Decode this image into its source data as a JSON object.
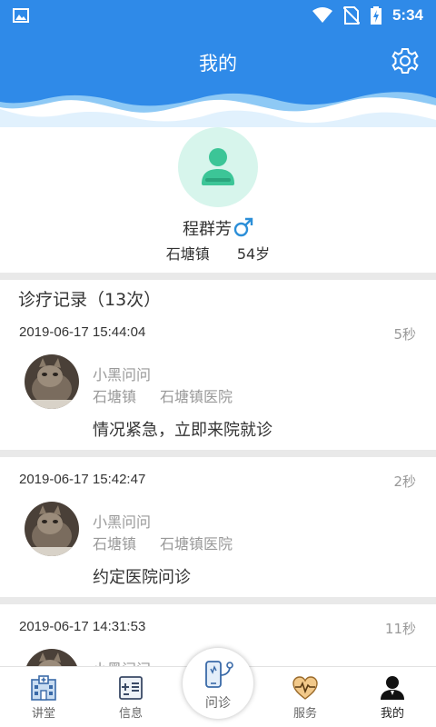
{
  "status_bar": {
    "time": "5:34"
  },
  "header": {
    "title": "我的"
  },
  "profile": {
    "name": "程群芳",
    "town": "石塘镇",
    "age": "54岁"
  },
  "records_title": "诊疗记录（13次）",
  "records": [
    {
      "datetime": "2019-06-17 15:44:04",
      "duration": "5秒",
      "doctor": "小黑问问",
      "town": "石塘镇",
      "hospital": "石塘镇医院",
      "result": "情况紧急，立即来院就诊"
    },
    {
      "datetime": "2019-06-17 15:42:47",
      "duration": "2秒",
      "doctor": "小黑问问",
      "town": "石塘镇",
      "hospital": "石塘镇医院",
      "result": "约定医院问诊"
    },
    {
      "datetime": "2019-06-17 14:31:53",
      "duration": "11秒",
      "doctor": "小黑问问"
    }
  ],
  "tabs": [
    {
      "label": "讲堂",
      "icon": "hospital-icon"
    },
    {
      "label": "信息",
      "icon": "info-icon"
    },
    {
      "label": "问诊",
      "icon": "phone-stethoscope-icon"
    },
    {
      "label": "服务",
      "icon": "heart-pulse-icon"
    },
    {
      "label": "我的",
      "icon": "person-icon"
    }
  ],
  "colors": {
    "primary": "#2f8ae8",
    "wave_light": "#a9d5f7",
    "avatar_bg": "#d7f5ec",
    "avatar_fg": "#3cc597",
    "male_icon": "#2c8fd8"
  }
}
